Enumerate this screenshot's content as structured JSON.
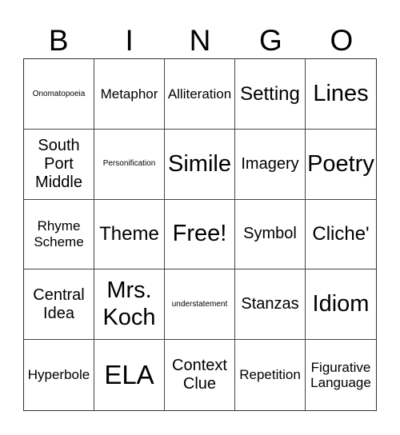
{
  "header": [
    "B",
    "I",
    "N",
    "G",
    "O"
  ],
  "cells": [
    {
      "text": "Onomatopoeia",
      "size": "s-xs"
    },
    {
      "text": "Metaphor",
      "size": "s-sm"
    },
    {
      "text": "Alliteration",
      "size": "s-sm"
    },
    {
      "text": "Setting",
      "size": "s-lg"
    },
    {
      "text": "Lines",
      "size": "s-xl"
    },
    {
      "text": "South Port Middle",
      "size": "s-md"
    },
    {
      "text": "Personification",
      "size": "s-xs"
    },
    {
      "text": "Simile",
      "size": "s-xl"
    },
    {
      "text": "Imagery",
      "size": "s-md"
    },
    {
      "text": "Poetry",
      "size": "s-xl"
    },
    {
      "text": "Rhyme Scheme",
      "size": "s-sm"
    },
    {
      "text": "Theme",
      "size": "s-lg"
    },
    {
      "text": "Free!",
      "size": "s-xl"
    },
    {
      "text": "Symbol",
      "size": "s-md"
    },
    {
      "text": "Cliche'",
      "size": "s-lg"
    },
    {
      "text": "Central Idea",
      "size": "s-md"
    },
    {
      "text": "Mrs. Koch",
      "size": "s-xl"
    },
    {
      "text": "understatement",
      "size": "s-xs"
    },
    {
      "text": "Stanzas",
      "size": "s-md"
    },
    {
      "text": "Idiom",
      "size": "s-xl"
    },
    {
      "text": "Hyperbole",
      "size": "s-sm"
    },
    {
      "text": "ELA",
      "size": "s-xxl"
    },
    {
      "text": "Context Clue",
      "size": "s-md"
    },
    {
      "text": "Repetition",
      "size": "s-sm"
    },
    {
      "text": "Figurative Language",
      "size": "s-sm"
    }
  ]
}
